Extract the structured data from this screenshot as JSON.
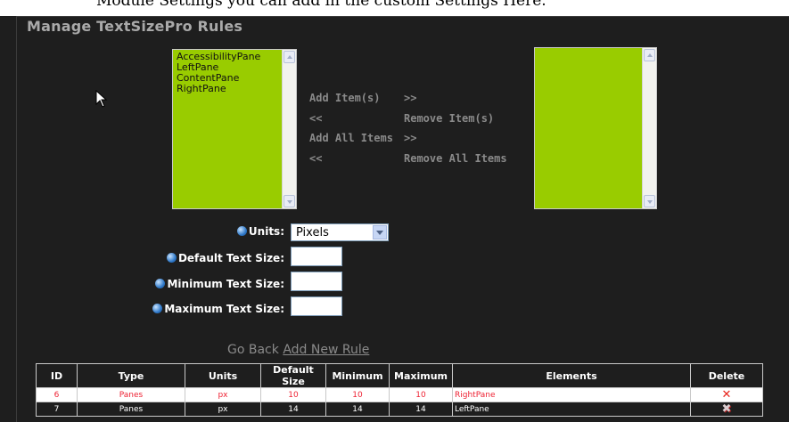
{
  "header_snippet": "Module Settings you can add in the custom Settings Here.",
  "title": "Manage TextSizePro Rules",
  "available_list": {
    "items": [
      "AccessibilityPane",
      "LeftPane",
      "ContentPane",
      "RightPane"
    ]
  },
  "selected_list": {
    "items": []
  },
  "actions": {
    "add_items": "Add Item(s)",
    "add_items_arrow": ">>",
    "remove_items_arrow": "<<",
    "remove_items": "Remove Item(s)",
    "add_all": "Add All Items",
    "add_all_arrow": ">>",
    "remove_all_arrow": "<<",
    "remove_all": "Remove All Items"
  },
  "form": {
    "units_label": "Units:",
    "units_value": "Pixels",
    "default_label": "Default Text Size:",
    "min_label": "Minimum Text Size:",
    "max_label": "Maximum Text Size:"
  },
  "links": {
    "go_back": "Go Back",
    "add_new_rule": "Add New Rule"
  },
  "table": {
    "headers": [
      "ID",
      "Type",
      "Units",
      "Default Size",
      "Minimum",
      "Maximum",
      "Elements",
      "Delete"
    ],
    "rows": [
      [
        "6",
        "Panes",
        "px",
        "10",
        "10",
        "10",
        "RightPane"
      ],
      [
        "7",
        "Panes",
        "px",
        "14",
        "14",
        "14",
        "LeftPane"
      ]
    ]
  },
  "colors": {
    "list_bg": "#99cc00",
    "panel_bg": "#1e1e1e",
    "delete_red": "#e8251d"
  }
}
